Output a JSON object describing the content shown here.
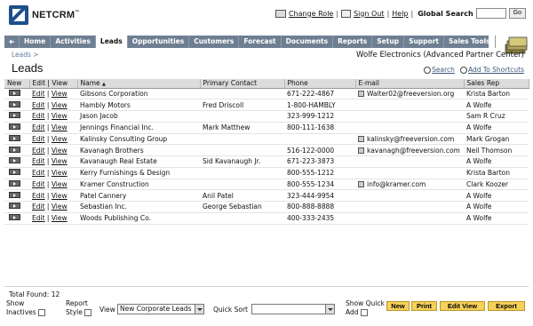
{
  "header": {
    "logo_text": "NETCRM",
    "logo_tm": "™",
    "change_role": "Change Role",
    "sign_out": "Sign Out",
    "help": "Help",
    "separator": "|",
    "global_search_label": "Global Search",
    "go_label": "Go"
  },
  "tabs": [
    "Home",
    "Activities",
    "Leads",
    "Opportunities",
    "Customers",
    "Forecast",
    "Documents",
    "Reports",
    "Setup",
    "Support",
    "Sales Tools"
  ],
  "active_tab": "Leads",
  "breadcrumb": "Leads >",
  "company": "Wolfe Electronics (Advanced Partner Center)",
  "page_title": "Leads",
  "actions": {
    "search": "Search",
    "add_to_shortcuts": "Add To Shortcuts"
  },
  "columns": {
    "new": "New",
    "edit_view": "Edit | View",
    "name": "Name",
    "contact": "Primary Contact",
    "phone": "Phone",
    "email": "E-mail",
    "rep": "Sales Rep"
  },
  "row_edit": "Edit",
  "row_sep": "|",
  "row_view": "View",
  "rows": [
    {
      "name": "Gibsons Corporation",
      "contact": "",
      "phone": "671-222-4867",
      "email": "Walter02@freeversion.org",
      "rep": "Krista Barton"
    },
    {
      "name": "Hambly Motors",
      "contact": "Fred Driscoll",
      "phone": "1-800-HAMBLY",
      "email": "",
      "rep": "A Wolfe"
    },
    {
      "name": "Jason Jacob",
      "contact": "",
      "phone": "323-999-1212",
      "email": "",
      "rep": "Sam R Cruz"
    },
    {
      "name": "Jennings Financial Inc.",
      "contact": "Mark Matthew",
      "phone": "800-111-1638",
      "email": "",
      "rep": "A Wolfe"
    },
    {
      "name": "Kalinsky Consulting Group",
      "contact": "",
      "phone": "",
      "email": "kalinsky@freeversion.com",
      "rep": "Mark Grogan"
    },
    {
      "name": "Kavanagh Brothers",
      "contact": "",
      "phone": "516-122-0000",
      "email": "kavanagh@freeversion.com",
      "rep": "Neil Thomson"
    },
    {
      "name": "Kavanaugh Real Estate",
      "contact": "Sid Kavanaugh Jr.",
      "phone": "671-223-3873",
      "email": "",
      "rep": "A Wolfe"
    },
    {
      "name": "Kerry Furnishings & Design",
      "contact": "",
      "phone": "800-555-1212",
      "email": "",
      "rep": "Krista Barton"
    },
    {
      "name": "Kramer Construction",
      "contact": "",
      "phone": "800-555-1234",
      "email": "info@kramer.com",
      "rep": "Clark Koozer"
    },
    {
      "name": "Patel Cannery",
      "contact": "Anil Patel",
      "phone": "323-444-9954",
      "email": "",
      "rep": "A Wolfe"
    },
    {
      "name": "Sebastian Inc.",
      "contact": "George Sebastian",
      "phone": "800-888-8888",
      "email": "",
      "rep": "A Wolfe"
    },
    {
      "name": "Woods Publishing Co.",
      "contact": "",
      "phone": "400-333-2435",
      "email": "",
      "rep": "A Wolfe"
    }
  ],
  "footer": {
    "total_found": "Total Found: 12",
    "show_label": "Show",
    "inactives_label": "Inactives",
    "report_label": "Report",
    "style_label": "Style",
    "view_label": "View",
    "view_value": "New Corporate Leads",
    "quick_sort_label": "Quick Sort",
    "quick_sort_value": "",
    "show_quick_label": "Show Quick",
    "add_label": "Add",
    "btn_new": "New",
    "btn_print": "Print",
    "btn_edit_view": "Edit View",
    "btn_export": "Export"
  }
}
